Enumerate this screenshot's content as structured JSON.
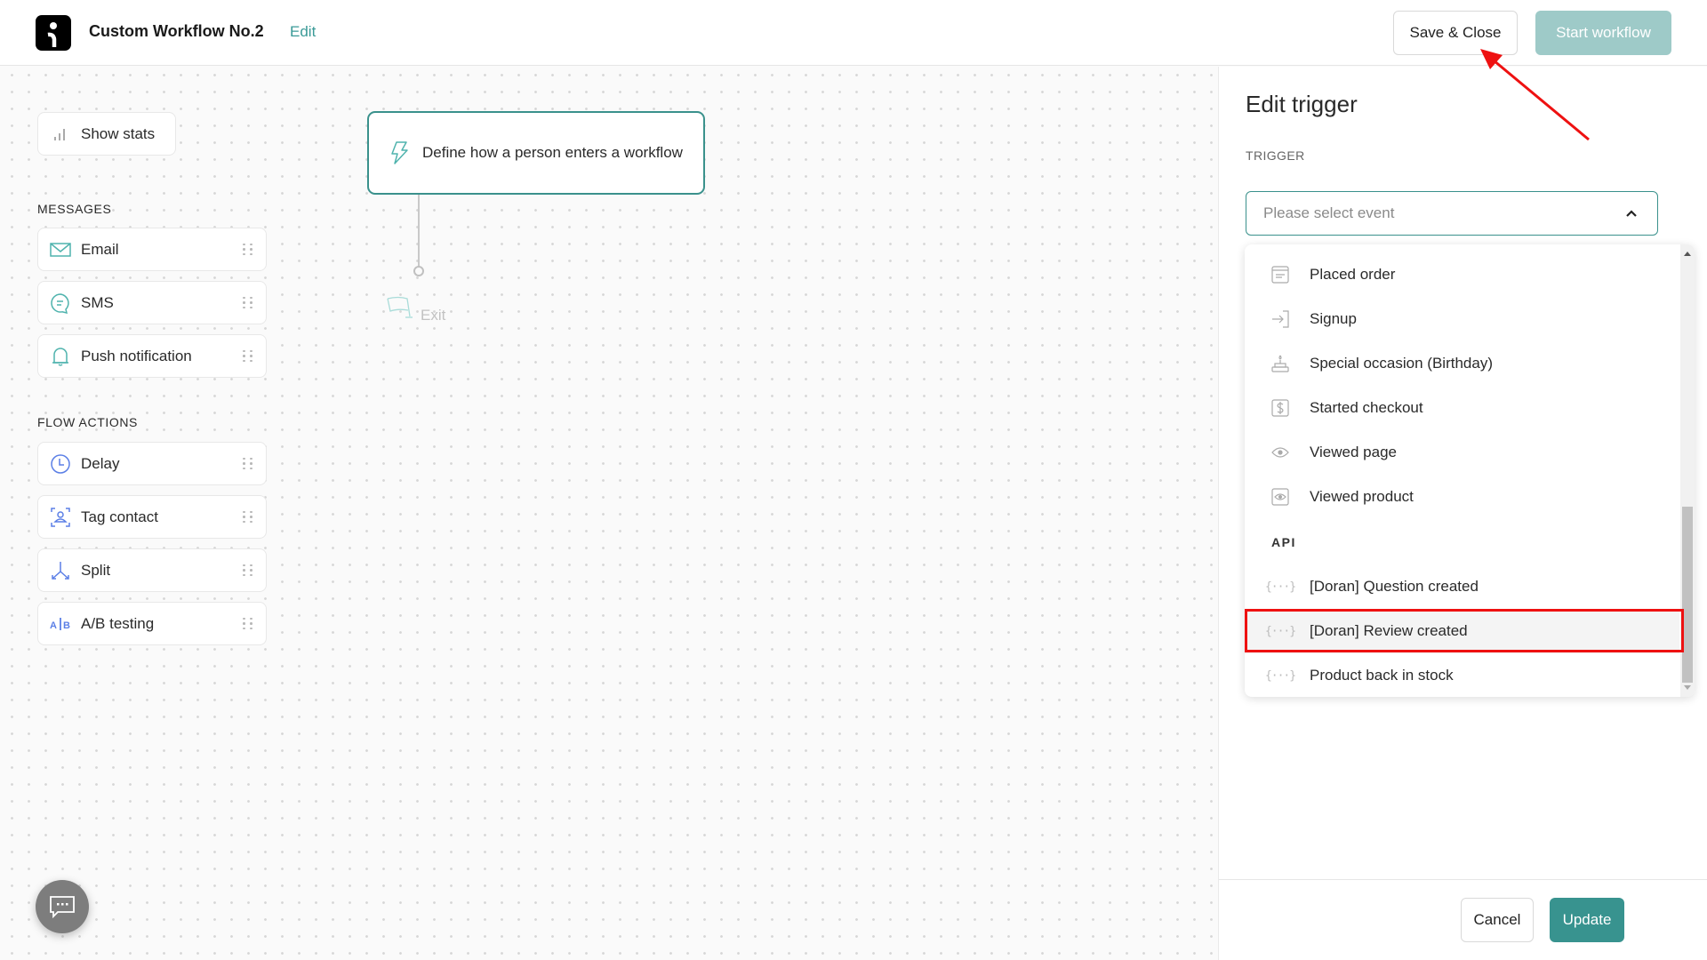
{
  "header": {
    "title": "Custom Workflow No.2",
    "edit_label": "Edit",
    "save_close_label": "Save & Close",
    "start_workflow_label": "Start workflow"
  },
  "sidebar": {
    "show_stats_label": "Show stats",
    "messages_heading": "MESSAGES",
    "messages": [
      {
        "label": "Email",
        "icon": "envelope-icon"
      },
      {
        "label": "SMS",
        "icon": "chat-bubble-icon"
      },
      {
        "label": "Push notification",
        "icon": "bell-icon"
      }
    ],
    "flow_actions_heading": "FLOW ACTIONS",
    "flow_actions": [
      {
        "label": "Delay",
        "icon": "clock-icon"
      },
      {
        "label": "Tag contact",
        "icon": "tag-contact-icon"
      },
      {
        "label": "Split",
        "icon": "split-icon"
      },
      {
        "label": "A/B testing",
        "icon": "ab-testing-icon"
      }
    ]
  },
  "canvas": {
    "trigger_node_label": "Define how a person enters a workflow",
    "exit_label": "Exit"
  },
  "panel": {
    "title": "Edit trigger",
    "trigger_label": "TRIGGER",
    "select_placeholder": "Please select event",
    "dropdown": {
      "items": [
        {
          "label": "Placed order",
          "icon": "receipt-icon"
        },
        {
          "label": "Signup",
          "icon": "sign-in-icon"
        },
        {
          "label": "Special occasion (Birthday)",
          "icon": "cake-icon"
        },
        {
          "label": "Started checkout",
          "icon": "dollar-icon"
        },
        {
          "label": "Viewed page",
          "icon": "eye-icon"
        },
        {
          "label": "Viewed product",
          "icon": "eye-box-icon"
        }
      ],
      "api_group_label": "API",
      "api_items": [
        {
          "label": "[Doran] Question created",
          "icon": "braces-icon"
        },
        {
          "label": "[Doran] Review created",
          "icon": "braces-icon",
          "highlighted": true
        },
        {
          "label": "Product back in stock",
          "icon": "braces-icon"
        }
      ],
      "braces_glyph": "{···}"
    },
    "cancel_label": "Cancel",
    "update_label": "Update"
  },
  "colors": {
    "accent": "#38938f",
    "accent_disabled": "#9ecac8",
    "annotation": "#ee1111",
    "message_icon": "#4fb3ad",
    "action_icon": "#5b7fe6"
  }
}
